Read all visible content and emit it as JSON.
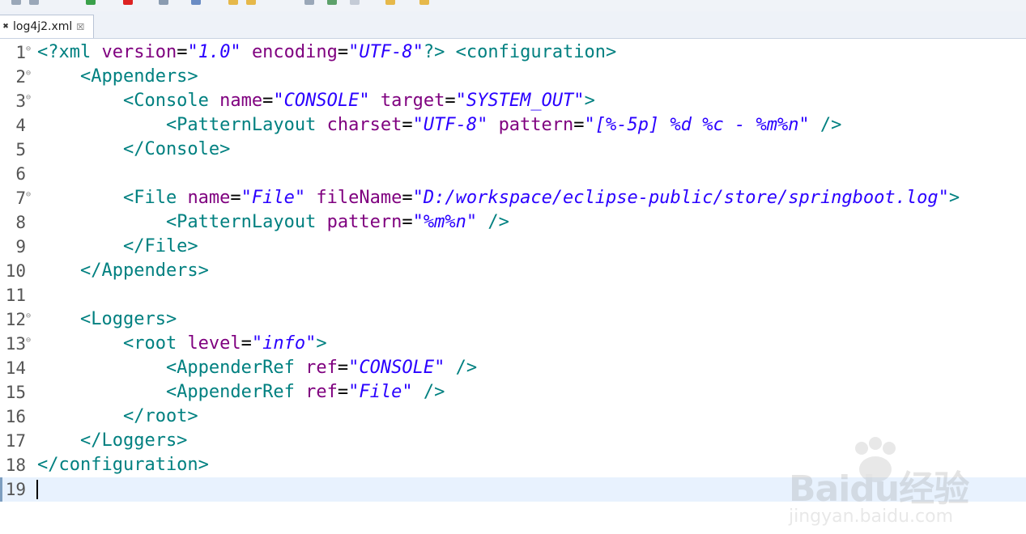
{
  "editor_tab": {
    "icon": "xml-file-icon",
    "label": "log4j2.xml",
    "close": "☒"
  },
  "lines": [
    {
      "n": "1",
      "fold": "⊖",
      "segs": [
        [
          "t",
          "<?xml "
        ],
        [
          "a",
          "version"
        ],
        [
          "e",
          "="
        ],
        [
          "q",
          "\"1.0\""
        ],
        [
          "e",
          " "
        ],
        [
          "a",
          "encoding"
        ],
        [
          "e",
          "="
        ],
        [
          "q",
          "\"UTF-8\""
        ],
        [
          "t",
          "?> <configuration>"
        ]
      ]
    },
    {
      "n": "2",
      "fold": "⊖",
      "segs": [
        [
          "t",
          "    <Appenders>"
        ]
      ]
    },
    {
      "n": "3",
      "fold": "⊖",
      "segs": [
        [
          "t",
          "        <Console "
        ],
        [
          "a",
          "name"
        ],
        [
          "e",
          "="
        ],
        [
          "q",
          "\"CONSOLE\""
        ],
        [
          "e",
          " "
        ],
        [
          "a",
          "target"
        ],
        [
          "e",
          "="
        ],
        [
          "q",
          "\"SYSTEM_OUT\""
        ],
        [
          "t",
          ">"
        ]
      ]
    },
    {
      "n": "4",
      "fold": "",
      "segs": [
        [
          "t",
          "            <PatternLayout "
        ],
        [
          "a",
          "charset"
        ],
        [
          "e",
          "="
        ],
        [
          "q",
          "\"UTF-8\""
        ],
        [
          "e",
          " "
        ],
        [
          "a",
          "pattern"
        ],
        [
          "e",
          "="
        ],
        [
          "q",
          "\"[%-5p] %d %c - %m%n\""
        ],
        [
          "t",
          " />"
        ]
      ]
    },
    {
      "n": "5",
      "fold": "",
      "segs": [
        [
          "t",
          "        </Console>"
        ]
      ]
    },
    {
      "n": "6",
      "fold": "",
      "segs": []
    },
    {
      "n": "7",
      "fold": "⊖",
      "segs": [
        [
          "t",
          "        <File "
        ],
        [
          "a",
          "name"
        ],
        [
          "e",
          "="
        ],
        [
          "q",
          "\"File\""
        ],
        [
          "e",
          " "
        ],
        [
          "a",
          "fileName"
        ],
        [
          "e",
          "="
        ],
        [
          "q",
          "\"D:/workspace/eclipse-public/store/springboot.log\""
        ],
        [
          "t",
          ">"
        ]
      ]
    },
    {
      "n": "8",
      "fold": "",
      "segs": [
        [
          "t",
          "            <PatternLayout "
        ],
        [
          "a",
          "pattern"
        ],
        [
          "e",
          "="
        ],
        [
          "q",
          "\"%m%n\""
        ],
        [
          "t",
          " />"
        ]
      ]
    },
    {
      "n": "9",
      "fold": "",
      "segs": [
        [
          "t",
          "        </File>"
        ]
      ]
    },
    {
      "n": "10",
      "fold": "",
      "segs": [
        [
          "t",
          "    </Appenders>"
        ]
      ]
    },
    {
      "n": "11",
      "fold": "",
      "segs": []
    },
    {
      "n": "12",
      "fold": "⊖",
      "segs": [
        [
          "t",
          "    <Loggers>"
        ]
      ]
    },
    {
      "n": "13",
      "fold": "⊖",
      "segs": [
        [
          "t",
          "        <root "
        ],
        [
          "a",
          "level"
        ],
        [
          "e",
          "="
        ],
        [
          "q",
          "\"info\""
        ],
        [
          "t",
          ">"
        ]
      ]
    },
    {
      "n": "14",
      "fold": "",
      "segs": [
        [
          "t",
          "            <AppenderRef "
        ],
        [
          "a",
          "ref"
        ],
        [
          "e",
          "="
        ],
        [
          "q",
          "\"CONSOLE\""
        ],
        [
          "t",
          " />"
        ]
      ]
    },
    {
      "n": "15",
      "fold": "",
      "segs": [
        [
          "t",
          "            <AppenderRef "
        ],
        [
          "a",
          "ref"
        ],
        [
          "e",
          "="
        ],
        [
          "q",
          "\"File\""
        ],
        [
          "t",
          " />"
        ]
      ]
    },
    {
      "n": "16",
      "fold": "",
      "segs": [
        [
          "t",
          "        </root>"
        ]
      ]
    },
    {
      "n": "17",
      "fold": "",
      "segs": [
        [
          "t",
          "    </Loggers>"
        ]
      ]
    },
    {
      "n": "18",
      "fold": "",
      "segs": [
        [
          "t",
          "</configuration>"
        ]
      ]
    },
    {
      "n": "19",
      "fold": "",
      "segs": []
    }
  ],
  "current_line": "19",
  "watermark": {
    "brand": "Baidu经验",
    "url": "jingyan.baidu.com"
  },
  "colors": {
    "tag": "#008080",
    "attribute": "#7f007f",
    "value": "#2a00ff",
    "current_line_bg": "#e8f2fe"
  }
}
